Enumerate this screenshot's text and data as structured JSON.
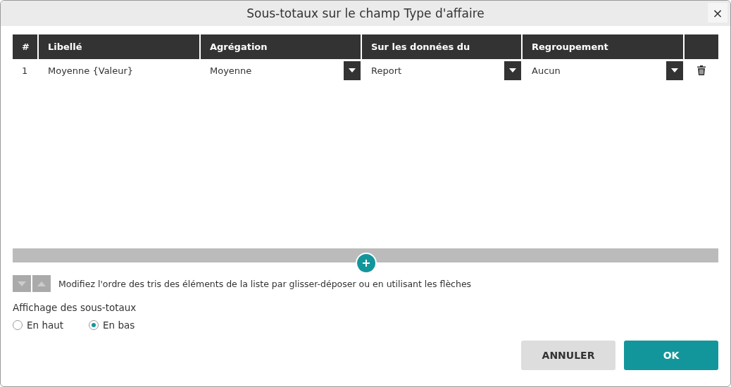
{
  "window": {
    "title": "Sous-totaux sur le champ Type d'affaire",
    "close": "×"
  },
  "table": {
    "columns": [
      "#",
      "Libellé",
      "Agrégation",
      "Sur les données du",
      "Regroupement"
    ],
    "rows": [
      {
        "number": "1",
        "label": "Moyenne {Valeur}",
        "aggregation": "Moyenne",
        "source": "Report",
        "grouping": "Aucun"
      }
    ]
  },
  "sort_hint": "Modifiez l'ordre des tris des éléments de la liste par glisser-déposer ou en utilisant les flèches",
  "display": {
    "label": "Affichage des sous-totaux",
    "options": [
      {
        "label": "En haut",
        "selected": false
      },
      {
        "label": "En bas",
        "selected": true
      }
    ]
  },
  "buttons": [
    {
      "label": "ANNULER",
      "kind": "secondary"
    },
    {
      "label": "OK",
      "kind": "primary"
    }
  ]
}
